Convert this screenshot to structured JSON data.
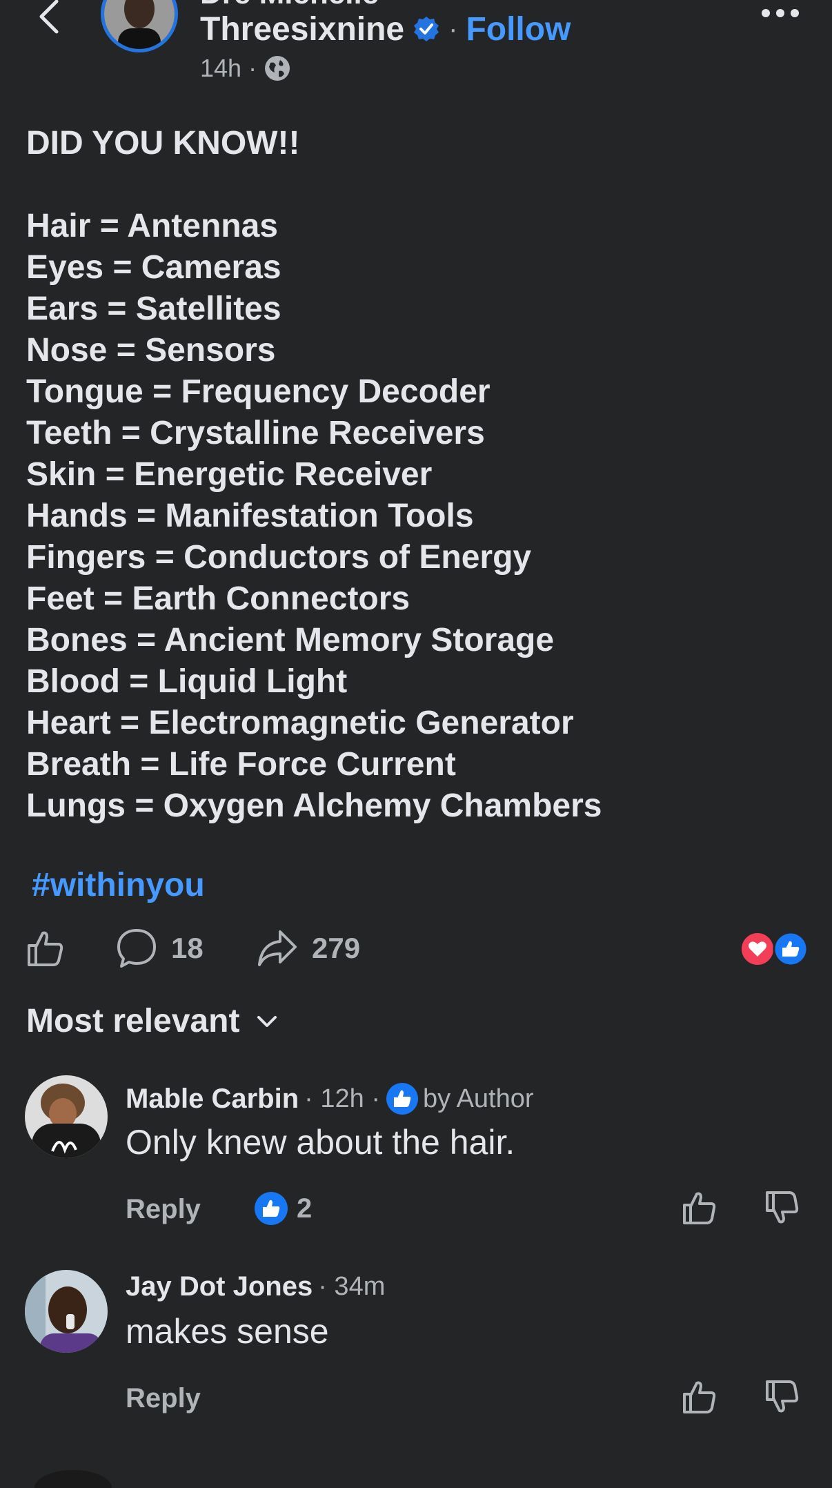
{
  "header": {
    "page_name_top": "Dre Michelle",
    "author_name": "Threesixnine",
    "follow_label": "Follow",
    "separator": "·",
    "post_time": "14h ·"
  },
  "post": {
    "text_lines": [
      "DID YOU KNOW!!",
      "",
      "Hair = Antennas",
      "Eyes = Cameras",
      "Ears = Satellites",
      "Nose = Sensors",
      "Tongue = Frequency Decoder",
      "Teeth = Crystalline Receivers",
      "Skin = Energetic Receiver",
      "Hands = Manifestation Tools",
      "Fingers = Conductors of Energy",
      "Feet = Earth Connectors",
      "Bones = Ancient Memory Storage",
      "Blood = Liquid Light",
      "Heart = Electromagnetic Generator",
      "Breath = Life Force Current",
      "Lungs = Oxygen Alchemy Chambers"
    ],
    "hashtag": "#withinyou",
    "comment_count": "18",
    "share_count": "279"
  },
  "sort": {
    "label": "Most relevant"
  },
  "comments": [
    {
      "name": "Mable Carbin",
      "time": "· 12h ·",
      "badge": "by Author",
      "text": "Only knew about the hair.",
      "reply_label": "Reply",
      "like_count": "2"
    },
    {
      "name": "Jay Dot Jones",
      "time": "· 34m",
      "text": "makes sense",
      "reply_label": "Reply"
    }
  ],
  "colors": {
    "background": "#242526",
    "text": "#e4e6eb",
    "secondary": "#b0b3b8",
    "link": "#4599ff",
    "verified": "#2374e1",
    "love": "#f33e58"
  }
}
